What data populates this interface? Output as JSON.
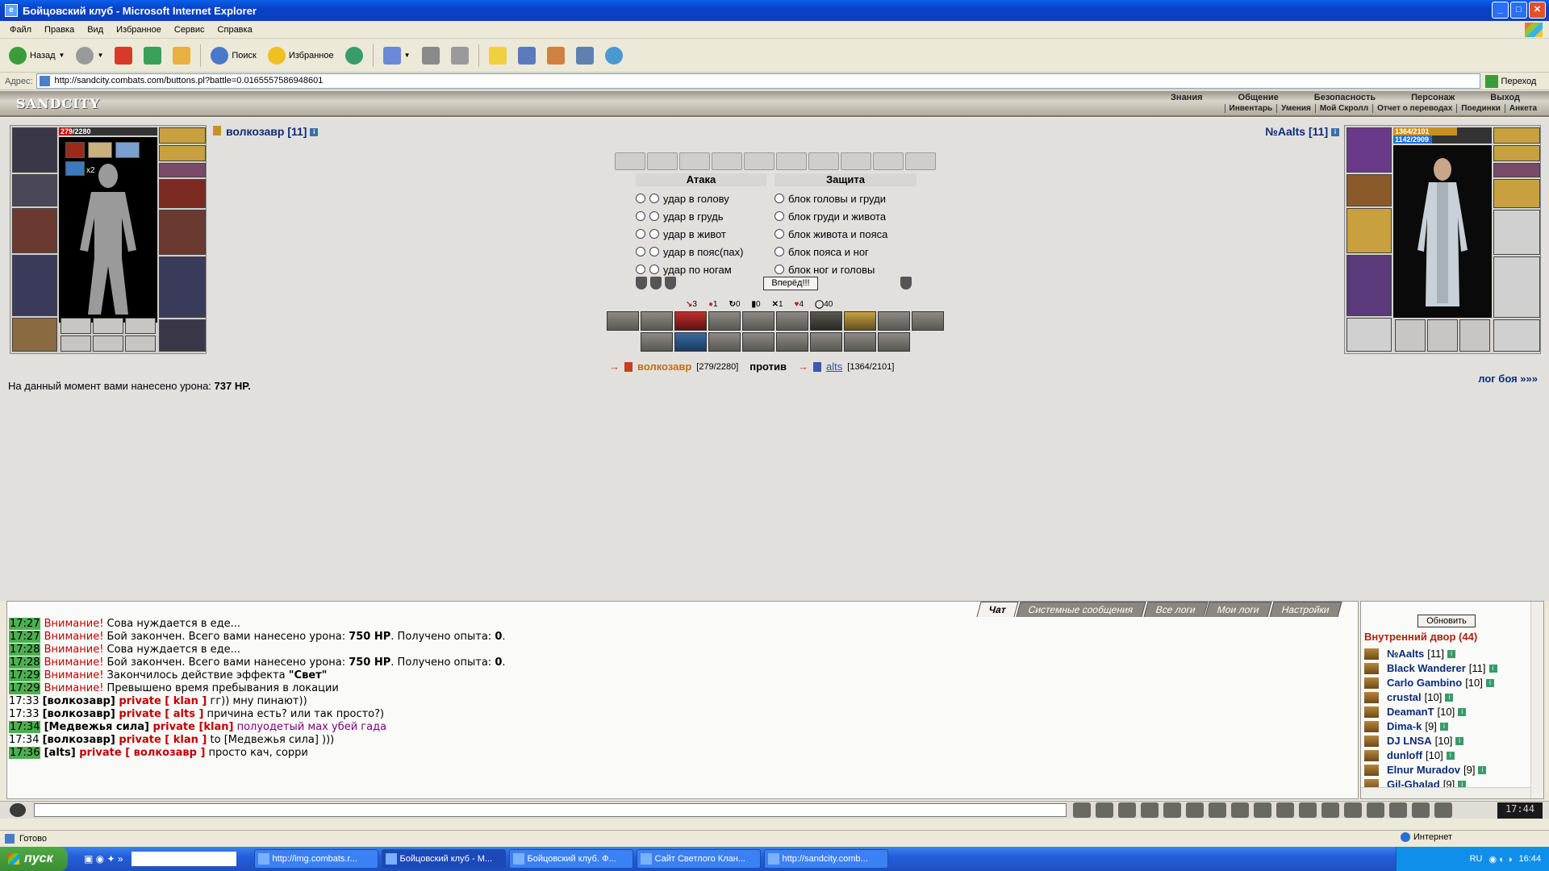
{
  "window": {
    "title": "Бойцовский клуб - Microsoft Internet Explorer"
  },
  "menu": [
    "Файл",
    "Правка",
    "Вид",
    "Избранное",
    "Сервис",
    "Справка"
  ],
  "toolbar": {
    "back": "Назад",
    "search": "Поиск",
    "favorites": "Избранное"
  },
  "address": {
    "label": "Адрес:",
    "url": "http://sandcity.combats.com/buttons.pl?battle=0.0165557586948601",
    "go": "Переход"
  },
  "site": {
    "logo": "SANDCITY",
    "nav": [
      "Знания",
      "Общение",
      "Безопасность",
      "Персонаж",
      "Выход"
    ],
    "subnav": [
      "Инвентарь",
      "Умения",
      "Мой Скролл",
      "Отчет о переводах",
      "Поединки",
      "Анкета"
    ]
  },
  "left_player": {
    "nick": "волкозавр [11]",
    "hp": "279/2280",
    "hp_fraction": 0.122,
    "extra": "x2"
  },
  "right_player": {
    "nick": "№Aalts [11]",
    "hp": "1364/2101",
    "mana": "1142/2909",
    "hp_fraction": 0.649,
    "mana_fraction": 0.393
  },
  "battle": {
    "attack_title": "Атака",
    "defense_title": "Защита",
    "attacks": [
      "удар в голову",
      "удар в грудь",
      "удар в живот",
      "удар в пояс(пах)",
      "удар по ногам"
    ],
    "defenses": [
      "блок головы и груди",
      "блок груди и живота",
      "блок живота и пояса",
      "блок пояса и ног",
      "блок ног и головы"
    ],
    "go_button": "Вперёд!!!",
    "stats": [
      "3",
      "1",
      "0",
      "0",
      "1",
      "4",
      "40"
    ],
    "vs": {
      "me": "волкозавр",
      "me_hp": "[279/2280]",
      "versus": "против",
      "enemy": "alts",
      "enemy_hp": "[1364/2101]"
    },
    "damage_text": "На данный момент вами нанесено урона:",
    "damage_value": "737 HP.",
    "log_link": "лог боя »»»"
  },
  "chat": {
    "tabs": [
      "Чат",
      "Системные сообщения",
      "Все логи",
      "Мои логи",
      "Настройки"
    ],
    "lines": [
      {
        "time": "17:27",
        "highlight": true,
        "parts": [
          {
            "t": "Внимание!",
            "c": "warn"
          },
          {
            "t": " Сова нуждается в еде...",
            "c": ""
          }
        ]
      },
      {
        "time": "17:27",
        "highlight": true,
        "parts": [
          {
            "t": "Внимание!",
            "c": "warn"
          },
          {
            "t": " Бой закончен. Всего вами нанесено урона: ",
            "c": ""
          },
          {
            "t": "750 HP",
            "c": "b"
          },
          {
            "t": ". Получено опыта: ",
            "c": ""
          },
          {
            "t": "0",
            "c": "b"
          },
          {
            "t": ".",
            "c": ""
          }
        ]
      },
      {
        "time": "17:28",
        "highlight": true,
        "parts": [
          {
            "t": "Внимание!",
            "c": "warn"
          },
          {
            "t": " Сова нуждается в еде...",
            "c": ""
          }
        ]
      },
      {
        "time": "17:28",
        "highlight": true,
        "parts": [
          {
            "t": "Внимание!",
            "c": "warn"
          },
          {
            "t": " Бой закончен. Всего вами нанесено урона: ",
            "c": ""
          },
          {
            "t": "750 HP",
            "c": "b"
          },
          {
            "t": ". Получено опыта: ",
            "c": ""
          },
          {
            "t": "0",
            "c": "b"
          },
          {
            "t": ".",
            "c": ""
          }
        ]
      },
      {
        "time": "17:29",
        "highlight": true,
        "parts": [
          {
            "t": "Внимание!",
            "c": "warn"
          },
          {
            "t": " Закончилось действие эффекта ",
            "c": ""
          },
          {
            "t": "\"Свет\"",
            "c": "b"
          }
        ]
      },
      {
        "time": "17:29",
        "highlight": true,
        "parts": [
          {
            "t": "Внимание!",
            "c": "warn"
          },
          {
            "t": " Превышено время пребывания в локации",
            "c": ""
          }
        ]
      },
      {
        "time": "17:33",
        "highlight": false,
        "parts": [
          {
            "t": "[волкозавр]",
            "c": "b"
          },
          {
            "t": " private [ klan ]",
            "c": "priv"
          },
          {
            "t": " гг)) мну пинают))",
            "c": ""
          }
        ]
      },
      {
        "time": "17:33",
        "highlight": false,
        "parts": [
          {
            "t": "[волкозавр]",
            "c": "b"
          },
          {
            "t": " private [ alts ]",
            "c": "priv"
          },
          {
            "t": " причина есть? или так просто?)",
            "c": ""
          }
        ]
      },
      {
        "time": "17:34",
        "highlight": true,
        "parts": [
          {
            "t": "[Медвежья сила]",
            "c": "b"
          },
          {
            "t": " private [klan]",
            "c": "priv"
          },
          {
            "t": " полуодетый мах убей гада",
            "c": "purple"
          }
        ]
      },
      {
        "time": "17:34",
        "highlight": false,
        "parts": [
          {
            "t": "[волкозавр]",
            "c": "b"
          },
          {
            "t": " private [ klan ]",
            "c": "priv"
          },
          {
            "t": " to [Медвежья сила] )))",
            "c": ""
          }
        ]
      },
      {
        "time": "17:36",
        "highlight": true,
        "parts": [
          {
            "t": "[alts]",
            "c": "b"
          },
          {
            "t": " private [ волкозавр ]",
            "c": "priv"
          },
          {
            "t": " просто кач, сорри",
            "c": ""
          }
        ]
      }
    ]
  },
  "roster": {
    "refresh": "Обновить",
    "room": "Внутренний двор (44)",
    "players": [
      {
        "name": "№Aalts",
        "level": "[11]"
      },
      {
        "name": "Black Wanderer",
        "level": "[11]"
      },
      {
        "name": "Carlo Gambino",
        "level": "[10]"
      },
      {
        "name": "crustal",
        "level": "[10]"
      },
      {
        "name": "DeamanT",
        "level": "[10]"
      },
      {
        "name": "Dima-k",
        "level": "[9]"
      },
      {
        "name": "DJ LNSA",
        "level": "[10]"
      },
      {
        "name": "dunloff",
        "level": "[10]"
      },
      {
        "name": "Elnur Muradov",
        "level": "[9]"
      },
      {
        "name": "Gil-Ghalad",
        "level": "[9]"
      }
    ]
  },
  "clock": "17:44",
  "status": {
    "ready": "Готово",
    "zone": "Интернет"
  },
  "taskbar": {
    "start": "пуск",
    "tasks": [
      "http://img.combats.r...",
      "Бойцовский клуб - М...",
      "Бойцовский клуб. Ф...",
      "Сайт Светлого Клан...",
      "http://sandcity.comb..."
    ],
    "lang": "RU",
    "time": "16:44"
  }
}
